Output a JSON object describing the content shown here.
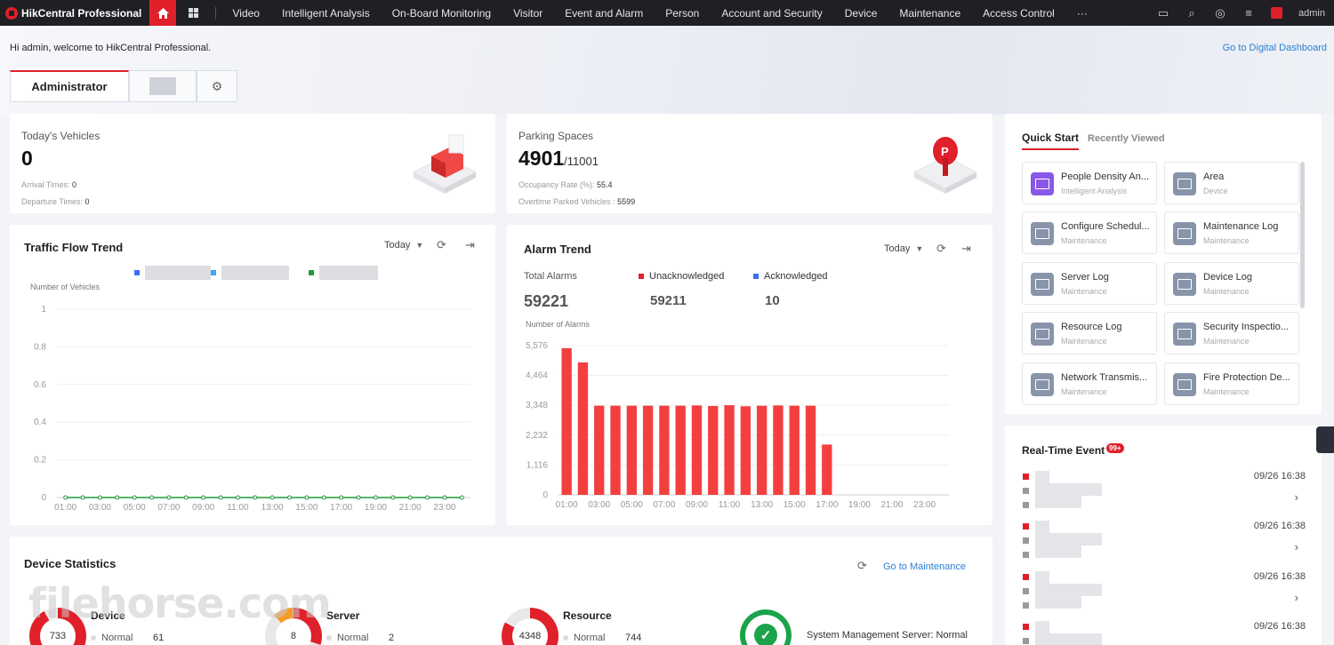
{
  "topbar": {
    "brand": "HikCentral Professional",
    "nav": [
      "Video",
      "Intelligent Analysis",
      "On-Board Monitoring",
      "Visitor",
      "Event and Alarm",
      "Person",
      "Account and Security",
      "Device",
      "Maintenance",
      "Access Control",
      "···"
    ],
    "user": "admin",
    "icons": [
      "folder-icon",
      "search-icon",
      "compass-icon",
      "list-icon",
      "notification-icon"
    ]
  },
  "header": {
    "welcome": "Hi admin, welcome to HikCentral Professional.",
    "digital_dashboard_link": "Go to Digital Dashboard",
    "tabs": [
      "Administrator"
    ]
  },
  "vehicles": {
    "label": "Today's Vehicles",
    "value": "0",
    "arrival_label": "Arrival Times:",
    "arrival_value": "0",
    "departure_label": "Departure Times:",
    "departure_value": "0"
  },
  "parking": {
    "label": "Parking Spaces",
    "value": "4901",
    "total": "/11001",
    "occupancy_label": "Occupancy Rate (%):",
    "occupancy_value": "55.4",
    "overtime_label": "Overtime Parked Vehicles :",
    "overtime_value": "5599"
  },
  "traffic": {
    "title": "Traffic Flow Trend",
    "range": "Today",
    "legend_colors": [
      "#3b6ef5",
      "#3aa8f5",
      "#1f9b3a"
    ]
  },
  "alarm": {
    "title": "Alarm Trend",
    "range": "Today",
    "total_label": "Total Alarms",
    "total_value": "59221",
    "unack_label": "Unacknowledged",
    "unack_value": "59211",
    "ack_label": "Acknowledged",
    "ack_value": "10",
    "unack_color": "#e0202a",
    "ack_color": "#3b6ef5"
  },
  "chart_data": [
    {
      "type": "line",
      "ylabel": "Number of Vehicles",
      "x": [
        "01:00",
        "02:00",
        "03:00",
        "04:00",
        "05:00",
        "06:00",
        "07:00",
        "08:00",
        "09:00",
        "10:00",
        "11:00",
        "12:00",
        "13:00",
        "14:00",
        "15:00",
        "16:00",
        "17:00",
        "18:00",
        "19:00",
        "20:00",
        "21:00",
        "22:00",
        "23:00",
        "24:00"
      ],
      "x_ticks": [
        "01:00",
        "03:00",
        "05:00",
        "07:00",
        "09:00",
        "11:00",
        "13:00",
        "15:00",
        "17:00",
        "19:00",
        "21:00",
        "23:00"
      ],
      "y_ticks": [
        "0",
        "0.2",
        "0.4",
        "0.6",
        "0.8",
        "1"
      ],
      "ylim": [
        0,
        1
      ],
      "series": [
        {
          "values": [
            0,
            0,
            0,
            0,
            0,
            0,
            0,
            0,
            0,
            0,
            0,
            0,
            0,
            0,
            0,
            0,
            0,
            0,
            0,
            0,
            0,
            0,
            0,
            0
          ],
          "color": "#1f9b3a"
        }
      ]
    },
    {
      "type": "bar",
      "ylabel": "Number of Alarms",
      "x": [
        "01:00",
        "02:00",
        "03:00",
        "04:00",
        "05:00",
        "06:00",
        "07:00",
        "08:00",
        "09:00",
        "10:00",
        "11:00",
        "12:00",
        "13:00",
        "14:00",
        "15:00",
        "16:00",
        "17:00",
        "18:00",
        "19:00",
        "20:00",
        "21:00",
        "22:00",
        "23:00",
        "24:00"
      ],
      "x_ticks": [
        "01:00",
        "03:00",
        "05:00",
        "07:00",
        "09:00",
        "11:00",
        "13:00",
        "15:00",
        "17:00",
        "19:00",
        "21:00",
        "23:00"
      ],
      "y_ticks": [
        "0",
        "1,116",
        "2,232",
        "3,348",
        "4,464",
        "5,576"
      ],
      "ylim": [
        0,
        5576
      ],
      "values": [
        5480,
        4950,
        3330,
        3330,
        3330,
        3330,
        3330,
        3330,
        3340,
        3320,
        3350,
        3310,
        3330,
        3340,
        3330,
        3330,
        1880,
        0,
        0,
        0,
        0,
        0,
        0,
        0
      ],
      "color": "#f43f3f"
    }
  ],
  "quick_start": {
    "tab_active": "Quick Start",
    "tab_other": "Recently Viewed",
    "tiles": [
      {
        "name": "People Density An...",
        "sub": "Intelligent Analysis",
        "icon": "people-density-icon"
      },
      {
        "name": "Area",
        "sub": "Device",
        "icon": "area-icon"
      },
      {
        "name": "Configure Schedul...",
        "sub": "Maintenance",
        "icon": "maintenance-icon"
      },
      {
        "name": "Maintenance Log",
        "sub": "Maintenance",
        "icon": "maintenance-icon"
      },
      {
        "name": "Server Log",
        "sub": "Maintenance",
        "icon": "maintenance-icon"
      },
      {
        "name": "Device Log",
        "sub": "Maintenance",
        "icon": "maintenance-icon"
      },
      {
        "name": "Resource Log",
        "sub": "Maintenance",
        "icon": "maintenance-icon"
      },
      {
        "name": "Security Inspectio...",
        "sub": "Maintenance",
        "icon": "maintenance-icon"
      },
      {
        "name": "Network Transmis...",
        "sub": "Maintenance",
        "icon": "maintenance-icon"
      },
      {
        "name": "Fire Protection De...",
        "sub": "Maintenance",
        "icon": "maintenance-icon"
      }
    ]
  },
  "realtime": {
    "title": "Real-Time Event",
    "badge": "99+",
    "events": [
      {
        "time": "09/26 16:38"
      },
      {
        "time": "09/26 16:38"
      },
      {
        "time": "09/26 16:38"
      },
      {
        "time": "09/26 16:38"
      }
    ]
  },
  "device_stats": {
    "title": "Device Statistics",
    "goto": "Go to Maintenance",
    "device": {
      "name": "Device",
      "total": "733",
      "normal_label": "Normal",
      "normal_value": "61"
    },
    "server": {
      "name": "Server",
      "total": "8",
      "normal_label": "Normal",
      "normal_value": "2"
    },
    "resource": {
      "name": "Resource",
      "total": "4348",
      "normal_label": "Normal",
      "normal_value": "744"
    },
    "system": {
      "label": "System Management Server: Normal"
    }
  },
  "watermark": "filehorse.com"
}
